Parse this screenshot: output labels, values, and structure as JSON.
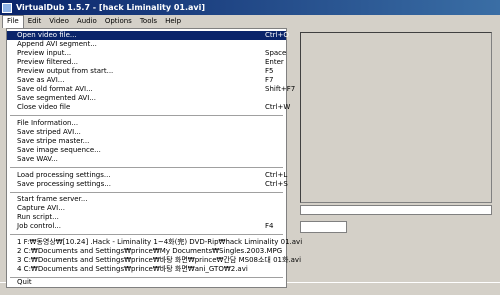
{
  "window": {
    "title": "VirtualDub 1.5.7 - [hack Liminality 01.avi]"
  },
  "menubar": [
    "File",
    "Edit",
    "Video",
    "Audio",
    "Options",
    "Tools",
    "Help"
  ],
  "file_menu": {
    "group1": [
      {
        "label": "Open video file...",
        "shortcut": "Ctrl+O"
      },
      {
        "label": "Append AVI segment...",
        "shortcut": ""
      },
      {
        "label": "Preview input...",
        "shortcut": "Space"
      },
      {
        "label": "Preview filtered...",
        "shortcut": "Enter"
      },
      {
        "label": "Preview output from start...",
        "shortcut": "F5"
      },
      {
        "label": "Save as AVI...",
        "shortcut": "F7"
      },
      {
        "label": "Save old format AVI...",
        "shortcut": "Shift+F7"
      },
      {
        "label": "Save segmented AVI...",
        "shortcut": ""
      },
      {
        "label": "Close video file",
        "shortcut": "Ctrl+W"
      }
    ],
    "group2": [
      {
        "label": "File Information...",
        "shortcut": ""
      },
      {
        "label": "Save striped AVI...",
        "shortcut": ""
      },
      {
        "label": "Save stripe master...",
        "shortcut": ""
      },
      {
        "label": "Save image sequence...",
        "shortcut": ""
      },
      {
        "label": "Save WAV...",
        "shortcut": ""
      }
    ],
    "group3": [
      {
        "label": "Load processing settings...",
        "shortcut": "Ctrl+L"
      },
      {
        "label": "Save processing settings...",
        "shortcut": "Ctrl+S"
      }
    ],
    "group4": [
      {
        "label": "Start frame server...",
        "shortcut": ""
      },
      {
        "label": "Capture AVI...",
        "shortcut": ""
      },
      {
        "label": "Run script...",
        "shortcut": ""
      },
      {
        "label": "Job control...",
        "shortcut": "F4"
      }
    ],
    "recent": [
      "1 F:₩동영상₩[10.24] .Hack - Liminality 1~4화(完) DVD-Rip₩hack Liminality 01.avi",
      "2 C:₩Documents and Settings₩prince₩My Documents₩Singles.2003.MPG",
      "3 C:₩Documents and Settings₩prince₩바탕 화면₩prince₩간담 MS08소대 01화.avi",
      "4 C:₩Documents and Settings₩prince₩바탕 화면₩ani_GTO₩2.avi"
    ],
    "quit": "Quit"
  }
}
